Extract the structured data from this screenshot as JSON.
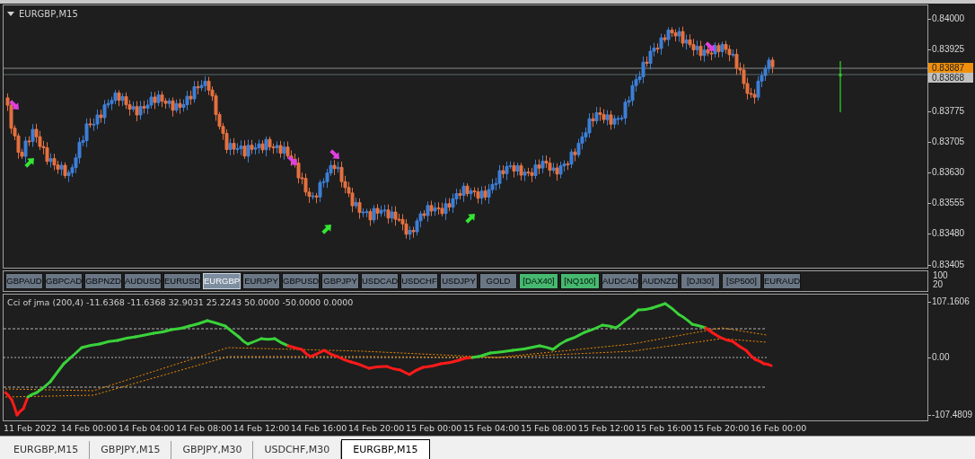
{
  "chart": {
    "title": "EURGBP,M15",
    "price_ticks": [
      "0.84000",
      "0.83925",
      "0.83775",
      "0.83705",
      "0.83630",
      "0.83555",
      "0.83480",
      "0.83405"
    ],
    "price_tags": [
      {
        "text": "0.83887",
        "kind": "ask"
      },
      {
        "text": "0.83868",
        "kind": "bid"
      }
    ],
    "signals": [
      {
        "kind": "sell"
      },
      {
        "kind": "buy"
      },
      {
        "kind": "sell"
      },
      {
        "kind": "buy"
      },
      {
        "kind": "sell"
      },
      {
        "kind": "buy"
      },
      {
        "kind": "sell"
      }
    ]
  },
  "symbol_buttons": [
    {
      "label": "GBPAUD",
      "selected": false,
      "highlighted": false
    },
    {
      "label": "GBPCAD",
      "selected": false,
      "highlighted": false
    },
    {
      "label": "GBPNZD",
      "selected": false,
      "highlighted": false
    },
    {
      "label": "AUDUSD",
      "selected": false,
      "highlighted": false
    },
    {
      "label": "EURUSD",
      "selected": false,
      "highlighted": false
    },
    {
      "label": "EURGBP",
      "selected": true,
      "highlighted": false
    },
    {
      "label": "EURJPY",
      "selected": false,
      "highlighted": false
    },
    {
      "label": "GBPUSD",
      "selected": false,
      "highlighted": false
    },
    {
      "label": "GBPJPY",
      "selected": false,
      "highlighted": false
    },
    {
      "label": "USDCAD",
      "selected": false,
      "highlighted": false
    },
    {
      "label": "USDCHF",
      "selected": false,
      "highlighted": false
    },
    {
      "label": "USDJPY",
      "selected": false,
      "highlighted": false
    },
    {
      "label": "GOLD",
      "selected": false,
      "highlighted": false
    },
    {
      "label": "[DAX40]",
      "selected": false,
      "highlighted": true
    },
    {
      "label": "[NQ100]",
      "selected": false,
      "highlighted": true
    },
    {
      "label": "AUDCAD",
      "selected": false,
      "highlighted": false
    },
    {
      "label": "AUDNZD",
      "selected": false,
      "highlighted": false
    },
    {
      "label": "[DJI30]",
      "selected": false,
      "highlighted": false
    },
    {
      "label": "[SP500]",
      "selected": false,
      "highlighted": false
    },
    {
      "label": "EURAUD",
      "selected": false,
      "highlighted": false
    }
  ],
  "row_scale": [
    "100",
    "20"
  ],
  "indicator": {
    "title": "Cci of jma (200,4) -11.6368 -11.6368 32.9031 25.2243 50.0000 -50.0000 0.0000",
    "ticks": [
      "107.1606",
      "0.00",
      "-107.4809"
    ]
  },
  "time_axis": [
    "11 Feb 2022",
    "14 Feb 00:00",
    "14 Feb 04:00",
    "14 Feb 08:00",
    "14 Feb 12:00",
    "14 Feb 16:00",
    "14 Feb 20:00",
    "15 Feb 00:00",
    "15 Feb 04:00",
    "15 Feb 08:00",
    "15 Feb 12:00",
    "15 Feb 16:00",
    "15 Feb 20:00",
    "16 Feb 00:00"
  ],
  "tabs": [
    {
      "label": "EURGBP,M15",
      "selected": false
    },
    {
      "label": "GBPJPY,M15",
      "selected": false
    },
    {
      "label": "GBPJPY,M30",
      "selected": false
    },
    {
      "label": "USDCHF,M30",
      "selected": false
    },
    {
      "label": "EURGBP,M15",
      "selected": true
    }
  ]
}
